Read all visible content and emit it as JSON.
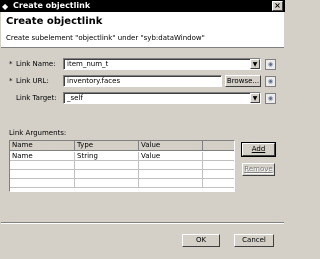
{
  "window": {
    "title": "Create objectlink",
    "close_glyph": "×"
  },
  "header": {
    "heading": "Create objectlink",
    "description": "Create subelement \"objectlink\" under \"syb:dataWindow\""
  },
  "form": {
    "link_name": {
      "required_mark": "*",
      "label": "Link Name:",
      "value": "item_num_t",
      "dropdown_glyph": "▼",
      "help_glyph": "◉"
    },
    "link_url": {
      "required_mark": "*",
      "label": "Link URL:",
      "value": "inventory.faces",
      "browse_label": "Browse...",
      "dropdown_glyph": "▼",
      "help_glyph": "◉"
    },
    "link_target": {
      "label": "Link Target:",
      "value": "_self",
      "dropdown_glyph": "▼",
      "help_glyph": "◉"
    }
  },
  "arguments": {
    "section_label": "Link Arguments:",
    "columns": [
      "Name",
      "Type",
      "Value",
      ""
    ],
    "rows": [
      [
        "Name",
        "String",
        "Value",
        ""
      ],
      [
        "",
        "",
        "",
        ""
      ],
      [
        "",
        "",
        "",
        ""
      ],
      [
        "",
        "",
        "",
        ""
      ]
    ],
    "add_label": "Add",
    "remove_label": "Remove"
  },
  "footer": {
    "ok_label": "OK",
    "cancel_label": "Cancel"
  }
}
